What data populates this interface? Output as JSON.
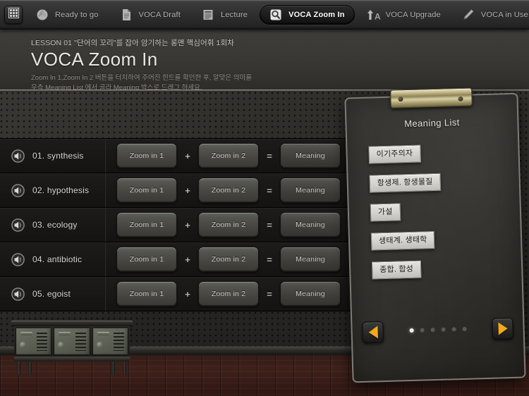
{
  "navbar": {
    "grid_icon": "grid-icon",
    "home_icon": "home-icon",
    "items": [
      {
        "label": "Ready to go",
        "icon": "sphere-icon",
        "active": false
      },
      {
        "label": "VOCA Draft",
        "icon": "document-icon",
        "active": false
      },
      {
        "label": "Lecture",
        "icon": "presentation-icon",
        "active": false
      },
      {
        "label": "VOCA Zoom In",
        "icon": "magnifier-icon",
        "active": true
      },
      {
        "label": "VOCA Upgrade",
        "icon": "arrow-up-a-icon",
        "active": false
      },
      {
        "label": "VOCA in Use",
        "icon": "pencil-icon",
        "active": false
      }
    ]
  },
  "lesson": {
    "kicker": "LESSON 01  \"단어의 꼬리\"를 잡아 암기하는 롱맨 핵심어휘 1회차",
    "title": "VOCA Zoom In",
    "desc_line1": "Zoom In 1,Zoom In 2 버튼을 터치하여 주어진 힌트를 확인한 후, 알맞은 의미를",
    "desc_line2": "우측 Meaning List 에서 골라 Meaning 박스로 드래그 하세요."
  },
  "wordlist": {
    "op_plus": "+",
    "op_equals": "=",
    "zoom1_label": "Zoom in 1",
    "zoom2_label": "Zoom in 2",
    "meaning_label": "Meaning",
    "rows": [
      {
        "word": "01. synthesis"
      },
      {
        "word": "02. hypothesis"
      },
      {
        "word": "03. ecology"
      },
      {
        "word": "04. antibiotic"
      },
      {
        "word": "05. egoist"
      }
    ]
  },
  "meaning_list": {
    "title": "Meaning List",
    "chips": [
      {
        "label": "이기주의자"
      },
      {
        "label": "항생제. 항생물질"
      },
      {
        "label": "가설"
      },
      {
        "label": "생태계. 생태학"
      },
      {
        "label": "종합. 합성"
      }
    ],
    "pager": {
      "prev_icon": "triangle-left-icon",
      "next_icon": "triangle-right-icon",
      "total_pages": 6,
      "current_page": 1
    }
  },
  "scene": {
    "locker_doors": 3
  },
  "colors": {
    "accent_orange": "#f4a91c",
    "panel_dark": "#343330",
    "chip_bg": "#d7d6d1",
    "text_light": "#e6e4de"
  }
}
